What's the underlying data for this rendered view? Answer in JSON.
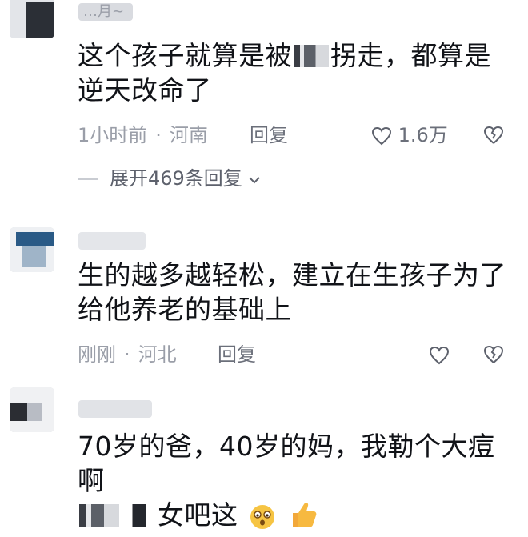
{
  "comments": [
    {
      "username": "…月~",
      "text_before": "这个孩子就算是被",
      "text_after": "拐走，都算是逆天改命了",
      "time": "1小时前",
      "location": "河南",
      "reply_label": "回复",
      "likes": "1.6万",
      "expand_label": "展开469条回复"
    },
    {
      "username": "",
      "text": "生的越多越轻松，建立在生孩子为了给他养老的基础上",
      "time": "刚刚",
      "location": "河北",
      "reply_label": "回复",
      "likes": ""
    },
    {
      "username": "",
      "text_line1": "70岁的爸，40岁的妈，我勒个大痘啊",
      "text_line2": "女吧这"
    }
  ],
  "colors": {
    "text": "#111318",
    "meta": "#9a9ea8",
    "secondary": "#6b6f7a"
  },
  "icons": [
    "heart-icon",
    "dislike-heart-icon",
    "chevron-down-icon",
    "emoji-icon",
    "thumbs-up-icon"
  ]
}
